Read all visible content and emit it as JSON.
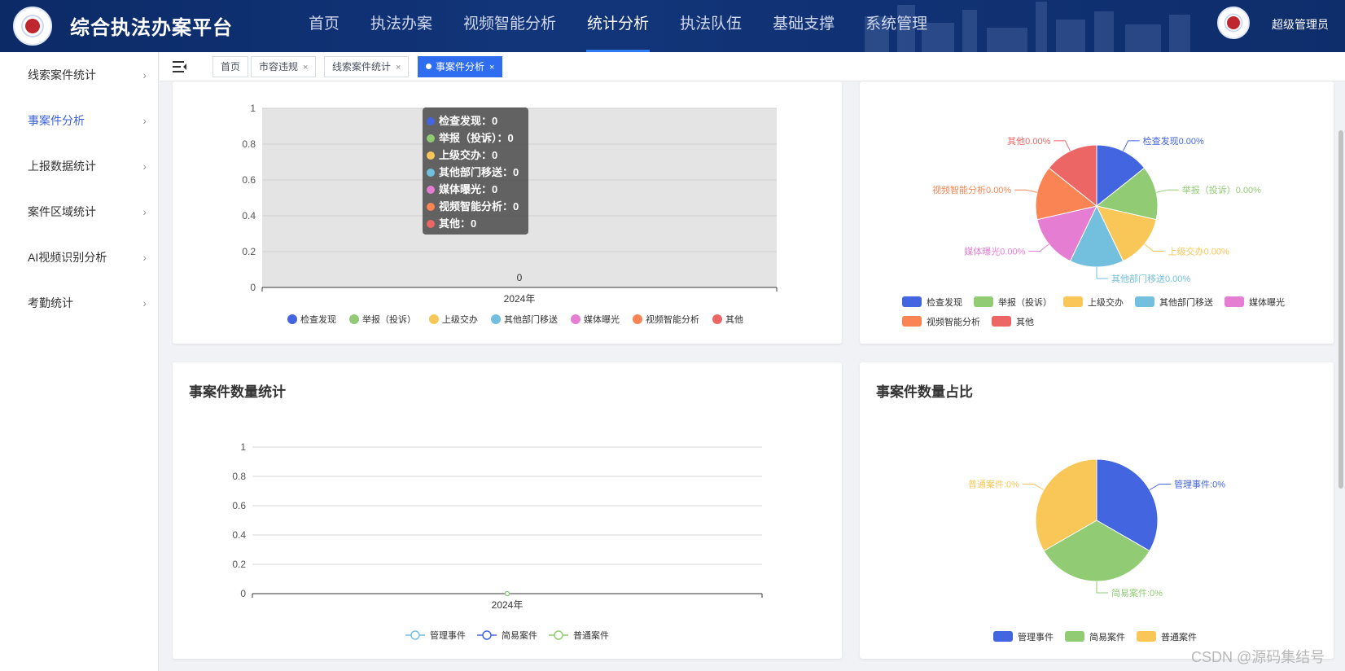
{
  "header": {
    "title": "综合执法办案平台",
    "nav": [
      {
        "label": "首页"
      },
      {
        "label": "执法办案"
      },
      {
        "label": "视频智能分析"
      },
      {
        "label": "统计分析",
        "active": true
      },
      {
        "label": "执法队伍"
      },
      {
        "label": "基础支撑"
      },
      {
        "label": "系统管理"
      }
    ],
    "user": "超级管理员"
  },
  "sidebar": {
    "items": [
      {
        "label": "线索案件统计"
      },
      {
        "label": "事案件分析",
        "active": true
      },
      {
        "label": "上报数据统计"
      },
      {
        "label": "案件区域统计"
      },
      {
        "label": "AI视频识别分析"
      },
      {
        "label": "考勤统计"
      }
    ]
  },
  "tabs": [
    {
      "label": "首页",
      "closable": false
    },
    {
      "label": "市容违规",
      "closable": true
    },
    {
      "label": "线索案件统计",
      "closable": true
    },
    {
      "label": "事案件分析",
      "closable": true,
      "active": true
    }
  ],
  "colors": {
    "blue": "#4465e0",
    "green": "#91cc75",
    "yellow": "#f8c757",
    "cyan": "#73c0de",
    "pink": "#e57dd2",
    "orange": "#fa8454",
    "red": "#ed6666"
  },
  "chart_data": [
    {
      "type": "bar",
      "categories": [
        "2024年"
      ],
      "series": [
        {
          "name": "检查发现",
          "values": [
            0
          ]
        },
        {
          "name": "举报（投诉）",
          "values": [
            0
          ]
        },
        {
          "name": "上级交办",
          "values": [
            0
          ]
        },
        {
          "name": "其他部门移送",
          "values": [
            0
          ]
        },
        {
          "name": "媒体曝光",
          "values": [
            0
          ]
        },
        {
          "name": "视频智能分析",
          "values": [
            0
          ]
        },
        {
          "name": "其他",
          "values": [
            0
          ]
        }
      ],
      "yticks": [
        "0",
        "0.2",
        "0.4",
        "0.6",
        "0.8",
        "1"
      ],
      "ylim": [
        0,
        1
      ],
      "data_label": "0",
      "legend": "bottom",
      "tooltip": {
        "rows": [
          {
            "label": "检查发现",
            "value": "0"
          },
          {
            "label": "举报（投诉）",
            "value": "0"
          },
          {
            "label": "上级交办",
            "value": "0"
          },
          {
            "label": "其他部门移送",
            "value": "0"
          },
          {
            "label": "媒体曝光",
            "value": "0"
          },
          {
            "label": "视频智能分析",
            "value": "0"
          },
          {
            "label": "其他",
            "value": "0"
          }
        ]
      }
    },
    {
      "type": "pie",
      "slices": [
        {
          "name": "检查发现",
          "value": 0,
          "label": "检查发现0.00%"
        },
        {
          "name": "举报（投诉）",
          "value": 0,
          "label": "举报（投诉）0.00%"
        },
        {
          "name": "上级交办",
          "value": 0,
          "label": "上级交办0.00%"
        },
        {
          "name": "其他部门移送",
          "value": 0,
          "label": "其他部门移送0.00%"
        },
        {
          "name": "媒体曝光",
          "value": 0,
          "label": "媒体曝光0.00%"
        },
        {
          "name": "视频智能分析",
          "value": 0,
          "label": "视频智能分析0.00%"
        },
        {
          "name": "其他",
          "value": 0,
          "label": "其他0.00%"
        }
      ],
      "legend": "bottom"
    },
    {
      "type": "line",
      "title": "事案件数量统计",
      "categories": [
        "2024年"
      ],
      "series": [
        {
          "name": "管理事件",
          "values": [
            0
          ]
        },
        {
          "name": "简易案件",
          "values": [
            0
          ]
        },
        {
          "name": "普通案件",
          "values": [
            0
          ]
        }
      ],
      "yticks": [
        "0",
        "0.2",
        "0.4",
        "0.6",
        "0.8",
        "1"
      ],
      "ylim": [
        0,
        1
      ],
      "legend": "bottom"
    },
    {
      "type": "pie",
      "title": "事案件数量占比",
      "slices": [
        {
          "name": "管理事件",
          "value": 0,
          "label": "管理事件:0%"
        },
        {
          "name": "简易案件",
          "value": 0,
          "label": "简易案件:0%"
        },
        {
          "name": "普通案件",
          "value": 0,
          "label": "普通案件:0%"
        }
      ],
      "legend": "bottom"
    }
  ],
  "watermark": "CSDN @源码集结号"
}
